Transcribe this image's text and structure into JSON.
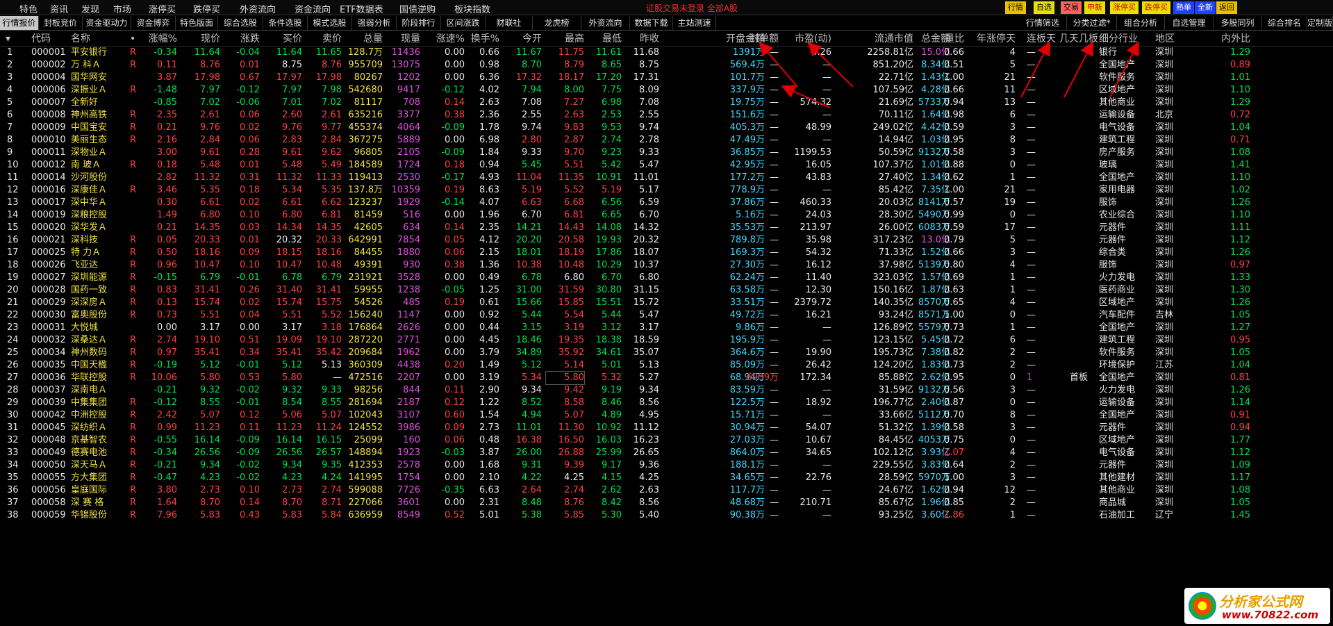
{
  "window": {
    "title": "证股交易未登录  全部A股"
  },
  "menu": [
    "特色",
    "资讯",
    "发现",
    "市场",
    "涨停买",
    "跌停买",
    "外资流向",
    "资金流向",
    "ETF数据表",
    "国债逆购",
    "板块指数"
  ],
  "quick_buttons": [
    "行情",
    "自选",
    "交易",
    "申新",
    "涨停买",
    "跌停买",
    "熟单",
    "全新",
    "返回"
  ],
  "tabs_left": [
    "行情报价",
    "封板竞价",
    "资金驱动力",
    "资金博弈",
    "特色版面",
    "综合选股",
    "条件选股",
    "模式选股",
    "强弱分析",
    "阶段排行",
    "区间涨跌",
    "财联社",
    "龙虎榜",
    "外资流向",
    "数据下载",
    "主站测速"
  ],
  "tabs_right": [
    "行情筛选",
    "分类过滤*",
    "组合分析",
    "自选管理",
    "多股同列",
    "综合排名",
    "定制版面"
  ],
  "columns": [
    "",
    "代码",
    "名称",
    "•",
    "涨幅%",
    "现价",
    "涨跌",
    "买价",
    "卖价",
    "总量",
    "现量",
    "涨速%",
    "换手%",
    "今开",
    "最高",
    "最低",
    "昨收",
    "开盘金额",
    "封单额",
    "市盈(动)",
    "流通市值",
    "总金额",
    "量比",
    "年涨停天",
    "连板天",
    "几天几板",
    "细分行业",
    "地区",
    "内外比"
  ],
  "rows": [
    [
      "1",
      "000001",
      "平安银行",
      "R",
      "-0.34",
      "11.64",
      "-0.04",
      "11.64",
      "11.65",
      "128.7万",
      "11436",
      "0.00",
      "0.66",
      "11.67",
      "11.75",
      "11.61",
      "11.68",
      "1391万",
      "—",
      "4.26",
      "2258.81亿",
      "15.0亿",
      "0.66",
      "4",
      "—",
      "",
      "银行",
      "深圳",
      "1.29"
    ],
    [
      "2",
      "000002",
      "万 科Ａ",
      "R",
      "0.11",
      "8.76",
      "0.01",
      "8.75",
      "8.76",
      "955709",
      "13075",
      "0.00",
      "0.98",
      "8.70",
      "8.79",
      "8.65",
      "8.75",
      "569.4万",
      "—",
      "—",
      "851.20亿",
      "8.34亿",
      "0.51",
      "5",
      "—",
      "",
      "全国地产",
      "深圳",
      "0.89"
    ],
    [
      "3",
      "000004",
      "国华网安",
      "",
      "3.87",
      "17.98",
      "0.67",
      "17.97",
      "17.98",
      "80267",
      "1202",
      "0.00",
      "6.36",
      "17.32",
      "18.17",
      "17.20",
      "17.31",
      "101.7万",
      "—",
      "—",
      "22.71亿",
      "1.43亿",
      "1.00",
      "21",
      "—",
      "",
      "软件服务",
      "深圳",
      "1.01"
    ],
    [
      "4",
      "000006",
      "深振业Ａ",
      "R",
      "-1.48",
      "7.97",
      "-0.12",
      "7.97",
      "7.98",
      "542680",
      "9417",
      "-0.12",
      "4.02",
      "7.94",
      "8.00",
      "7.75",
      "8.09",
      "337.9万",
      "—",
      "—",
      "107.59亿",
      "4.28亿",
      "0.66",
      "11",
      "—",
      "",
      "区域地产",
      "深圳",
      "1.10"
    ],
    [
      "5",
      "000007",
      "全新好",
      "",
      "-0.85",
      "7.02",
      "-0.06",
      "7.01",
      "7.02",
      "81117",
      "708",
      "0.14",
      "2.63",
      "7.08",
      "7.27",
      "6.98",
      "7.08",
      "19.75万",
      "—",
      "574.32",
      "21.69亿",
      "5733万",
      "0.94",
      "13",
      "—",
      "",
      "其他商业",
      "深圳",
      "1.29"
    ],
    [
      "6",
      "000008",
      "神州高铁",
      "R",
      "2.35",
      "2.61",
      "0.06",
      "2.60",
      "2.61",
      "635216",
      "3377",
      "0.38",
      "2.36",
      "2.55",
      "2.63",
      "2.53",
      "2.55",
      "151.6万",
      "—",
      "—",
      "70.11亿",
      "1.64亿",
      "0.98",
      "6",
      "—",
      "",
      "运输设备",
      "北京",
      "0.72"
    ],
    [
      "7",
      "000009",
      "中国宝安",
      "R",
      "0.21",
      "9.76",
      "0.02",
      "9.76",
      "9.77",
      "455374",
      "4064",
      "-0.09",
      "1.78",
      "9.74",
      "9.83",
      "9.53",
      "9.74",
      "405.3万",
      "—",
      "48.99",
      "249.02亿",
      "4.42亿",
      "0.59",
      "3",
      "—",
      "",
      "电气设备",
      "深圳",
      "1.04"
    ],
    [
      "8",
      "000010",
      "美丽生态",
      "R",
      "2.16",
      "2.84",
      "0.06",
      "2.83",
      "2.84",
      "367275",
      "5889",
      "0.00",
      "6.98",
      "2.80",
      "2.87",
      "2.74",
      "2.78",
      "47.49万",
      "—",
      "—",
      "14.94亿",
      "1.03亿",
      "0.95",
      "8",
      "—",
      "",
      "建筑工程",
      "深圳",
      "0.71"
    ],
    [
      "9",
      "000011",
      "深物业Ａ",
      "",
      "3.00",
      "9.61",
      "0.28",
      "9.61",
      "9.62",
      "96805",
      "2105",
      "-0.09",
      "1.84",
      "9.33",
      "9.70",
      "9.23",
      "9.33",
      "36.85万",
      "—",
      "1199.53",
      "50.59亿",
      "9132万",
      "0.58",
      "3",
      "—",
      "",
      "房产服务",
      "深圳",
      "1.08"
    ],
    [
      "10",
      "000012",
      "南 玻Ａ",
      "R",
      "0.18",
      "5.48",
      "0.01",
      "5.48",
      "5.49",
      "184589",
      "1724",
      "0.18",
      "0.94",
      "5.45",
      "5.51",
      "5.42",
      "5.47",
      "42.95万",
      "—",
      "16.05",
      "107.37亿",
      "1.01亿",
      "0.88",
      "0",
      "—",
      "",
      "玻璃",
      "深圳",
      "1.41"
    ],
    [
      "11",
      "000014",
      "沙河股份",
      "",
      "2.82",
      "11.32",
      "0.31",
      "11.32",
      "11.33",
      "119413",
      "2530",
      "-0.17",
      "4.93",
      "11.04",
      "11.35",
      "10.91",
      "11.01",
      "177.2万",
      "—",
      "43.83",
      "27.40亿",
      "1.34亿",
      "0.62",
      "1",
      "—",
      "",
      "全国地产",
      "深圳",
      "1.10"
    ],
    [
      "12",
      "000016",
      "深康佳Ａ",
      "R",
      "3.46",
      "5.35",
      "0.18",
      "5.34",
      "5.35",
      "137.8万",
      "10359",
      "0.19",
      "8.63",
      "5.19",
      "5.52",
      "5.19",
      "5.17",
      "778.9万",
      "—",
      "—",
      "85.42亿",
      "7.35亿",
      "1.00",
      "21",
      "—",
      "",
      "家用电器",
      "深圳",
      "1.02"
    ],
    [
      "13",
      "000017",
      "深中华Ａ",
      "",
      "0.30",
      "6.61",
      "0.02",
      "6.61",
      "6.62",
      "123237",
      "1929",
      "-0.14",
      "4.07",
      "6.63",
      "6.68",
      "6.56",
      "6.59",
      "37.86万",
      "—",
      "460.33",
      "20.03亿",
      "8141万",
      "0.57",
      "19",
      "—",
      "",
      "服饰",
      "深圳",
      "1.26"
    ],
    [
      "14",
      "000019",
      "深粮控股",
      "",
      "1.49",
      "6.80",
      "0.10",
      "6.80",
      "6.81",
      "81459",
      "516",
      "0.00",
      "1.96",
      "6.70",
      "6.81",
      "6.65",
      "6.70",
      "5.16万",
      "—",
      "24.03",
      "28.30亿",
      "5490万",
      "0.99",
      "0",
      "—",
      "",
      "农业综合",
      "深圳",
      "1.10"
    ],
    [
      "15",
      "000020",
      "深华发Ａ",
      "",
      "0.21",
      "14.35",
      "0.03",
      "14.34",
      "14.35",
      "42605",
      "634",
      "0.14",
      "2.35",
      "14.21",
      "14.43",
      "14.08",
      "14.32",
      "35.53万",
      "—",
      "213.97",
      "26.00亿",
      "6083万",
      "0.59",
      "17",
      "—",
      "",
      "元器件",
      "深圳",
      "1.11"
    ],
    [
      "16",
      "000021",
      "深科技",
      "R",
      "0.05",
      "20.33",
      "0.01",
      "20.32",
      "20.33",
      "642991",
      "7854",
      "0.05",
      "4.12",
      "20.20",
      "20.58",
      "19.93",
      "20.32",
      "789.8万",
      "—",
      "35.98",
      "317.23亿",
      "13.0亿",
      "0.79",
      "5",
      "—",
      "",
      "元器件",
      "深圳",
      "1.12"
    ],
    [
      "17",
      "000025",
      "特 力Ａ",
      "R",
      "0.50",
      "18.16",
      "0.09",
      "18.15",
      "18.16",
      "84455",
      "1880",
      "0.06",
      "2.15",
      "18.01",
      "18.19",
      "17.86",
      "18.07",
      "169.3万",
      "—",
      "54.32",
      "71.33亿",
      "1.52亿",
      "0.66",
      "3",
      "—",
      "",
      "综合类",
      "深圳",
      "1.26"
    ],
    [
      "18",
      "000026",
      "飞亚达",
      "R",
      "0.96",
      "10.47",
      "0.10",
      "10.47",
      "10.48",
      "49391",
      "930",
      "0.38",
      "1.36",
      "10.38",
      "10.48",
      "10.29",
      "10.37",
      "27.30万",
      "—",
      "16.12",
      "37.98亿",
      "5139万",
      "0.80",
      "4",
      "—",
      "",
      "服饰",
      "深圳",
      "0.97"
    ],
    [
      "19",
      "000027",
      "深圳能源",
      "R",
      "-0.15",
      "6.79",
      "-0.01",
      "6.78",
      "6.79",
      "231921",
      "3528",
      "0.00",
      "0.49",
      "6.78",
      "6.80",
      "6.70",
      "6.80",
      "62.24万",
      "—",
      "11.40",
      "323.03亿",
      "1.57亿",
      "0.69",
      "1",
      "—",
      "",
      "火力发电",
      "深圳",
      "1.33"
    ],
    [
      "20",
      "000028",
      "国药一致",
      "R",
      "0.83",
      "31.41",
      "0.26",
      "31.40",
      "31.41",
      "59955",
      "1238",
      "-0.05",
      "1.25",
      "31.00",
      "31.59",
      "30.80",
      "31.15",
      "63.58万",
      "—",
      "12.30",
      "150.16亿",
      "1.87亿",
      "0.63",
      "1",
      "—",
      "",
      "医药商业",
      "深圳",
      "1.30"
    ],
    [
      "21",
      "000029",
      "深深房Ａ",
      "R",
      "0.13",
      "15.74",
      "0.02",
      "15.74",
      "15.75",
      "54526",
      "485",
      "0.19",
      "0.61",
      "15.66",
      "15.85",
      "15.51",
      "15.72",
      "33.51万",
      "—",
      "2379.72",
      "140.35亿",
      "8570万",
      "0.65",
      "4",
      "—",
      "",
      "区域地产",
      "深圳",
      "1.26"
    ],
    [
      "22",
      "000030",
      "富奥股份",
      "R",
      "0.73",
      "5.51",
      "0.04",
      "5.51",
      "5.52",
      "156240",
      "1147",
      "0.00",
      "0.92",
      "5.44",
      "5.54",
      "5.44",
      "5.47",
      "49.72万",
      "—",
      "16.21",
      "93.24亿",
      "8571万",
      "1.00",
      "0",
      "—",
      "",
      "汽车配件",
      "吉林",
      "1.05"
    ],
    [
      "23",
      "000031",
      "大悦城",
      "",
      "0.00",
      "3.17",
      "0.00",
      "3.17",
      "3.18",
      "176864",
      "2626",
      "0.00",
      "0.44",
      "3.15",
      "3.19",
      "3.12",
      "3.17",
      "9.86万",
      "—",
      "—",
      "126.89亿",
      "5579万",
      "0.73",
      "1",
      "—",
      "",
      "全国地产",
      "深圳",
      "1.27"
    ],
    [
      "24",
      "000032",
      "深桑达Ａ",
      "R",
      "2.74",
      "19.10",
      "0.51",
      "19.09",
      "19.10",
      "287220",
      "2771",
      "0.00",
      "4.45",
      "18.46",
      "19.35",
      "18.38",
      "18.59",
      "195.9万",
      "—",
      "—",
      "123.15亿",
      "5.45亿",
      "0.72",
      "6",
      "—",
      "",
      "建筑工程",
      "深圳",
      "0.95"
    ],
    [
      "25",
      "000034",
      "神州数码",
      "R",
      "0.97",
      "35.41",
      "0.34",
      "35.41",
      "35.42",
      "209684",
      "1962",
      "0.00",
      "3.79",
      "34.89",
      "35.92",
      "34.61",
      "35.07",
      "364.6万",
      "—",
      "19.90",
      "195.73亿",
      "7.38亿",
      "0.82",
      "2",
      "—",
      "",
      "软件服务",
      "深圳",
      "1.05"
    ],
    [
      "26",
      "000035",
      "中国天楹",
      "R",
      "-0.19",
      "5.12",
      "-0.01",
      "5.12",
      "5.13",
      "360309",
      "4438",
      "0.20",
      "1.49",
      "5.12",
      "5.14",
      "5.01",
      "5.13",
      "85.09万",
      "—",
      "26.42",
      "124.20亿",
      "1.83亿",
      "0.73",
      "2",
      "—",
      "",
      "环境保护",
      "江苏",
      "1.04"
    ],
    [
      "27",
      "000036",
      "华联控股",
      "R",
      "10.06",
      "5.80",
      "0.53",
      "5.80",
      "—",
      "472516",
      "2207",
      "0.00",
      "3.19",
      "5.34",
      "5.80",
      "5.32",
      "5.27",
      "68.94万",
      "6939万",
      "172.34",
      "85.88亿",
      "2.62亿",
      "0.95",
      "0",
      "1",
      "首板",
      "全国地产",
      "深圳",
      "0.81"
    ],
    [
      "28",
      "000037",
      "深南电Ａ",
      "",
      "-0.21",
      "9.32",
      "-0.02",
      "9.32",
      "9.33",
      "98256",
      "844",
      "0.11",
      "2.90",
      "9.34",
      "9.42",
      "9.19",
      "9.34",
      "83.59万",
      "—",
      "—",
      "31.59亿",
      "9132万",
      "0.56",
      "3",
      "—",
      "",
      "火力发电",
      "深圳",
      "1.26"
    ],
    [
      "29",
      "000039",
      "中集集团",
      "R",
      "-0.12",
      "8.55",
      "-0.01",
      "8.54",
      "8.55",
      "281694",
      "2187",
      "0.12",
      "1.22",
      "8.52",
      "8.58",
      "8.46",
      "8.56",
      "122.5万",
      "—",
      "18.92",
      "196.77亿",
      "2.40亿",
      "0.87",
      "0",
      "—",
      "",
      "运输设备",
      "深圳",
      "1.14"
    ],
    [
      "30",
      "000042",
      "中洲控股",
      "R",
      "2.42",
      "5.07",
      "0.12",
      "5.06",
      "5.07",
      "102043",
      "3107",
      "0.60",
      "1.54",
      "4.94",
      "5.07",
      "4.89",
      "4.95",
      "15.71万",
      "—",
      "—",
      "33.66亿",
      "5112万",
      "0.70",
      "8",
      "—",
      "",
      "全国地产",
      "深圳",
      "0.91"
    ],
    [
      "31",
      "000045",
      "深纺织Ａ",
      "R",
      "0.99",
      "11.23",
      "0.11",
      "11.23",
      "11.24",
      "124552",
      "3986",
      "0.09",
      "2.73",
      "11.01",
      "11.30",
      "10.92",
      "11.12",
      "30.94万",
      "—",
      "54.07",
      "51.32亿",
      "1.39亿",
      "0.58",
      "3",
      "—",
      "",
      "元器件",
      "深圳",
      "0.94"
    ],
    [
      "32",
      "000048",
      "京基智农",
      "R",
      "-0.55",
      "16.14",
      "-0.09",
      "16.14",
      "16.15",
      "25099",
      "160",
      "0.06",
      "0.48",
      "16.38",
      "16.50",
      "16.03",
      "16.23",
      "27.03万",
      "—",
      "10.67",
      "84.45亿",
      "4053万",
      "0.75",
      "0",
      "—",
      "",
      "区域地产",
      "深圳",
      "1.77"
    ],
    [
      "33",
      "000049",
      "德赛电池",
      "R",
      "-0.34",
      "26.56",
      "-0.09",
      "26.56",
      "26.57",
      "148894",
      "1923",
      "-0.03",
      "3.87",
      "26.00",
      "26.88",
      "25.99",
      "26.65",
      "864.0万",
      "—",
      "34.65",
      "102.12亿",
      "3.93亿",
      "1.07",
      "4",
      "—",
      "",
      "电气设备",
      "深圳",
      "1.12"
    ],
    [
      "34",
      "000050",
      "深天马Ａ",
      "R",
      "-0.21",
      "9.34",
      "-0.02",
      "9.34",
      "9.35",
      "412353",
      "2578",
      "0.00",
      "1.68",
      "9.31",
      "9.39",
      "9.17",
      "9.36",
      "188.1万",
      "—",
      "—",
      "229.55亿",
      "3.83亿",
      "0.64",
      "2",
      "—",
      "",
      "元器件",
      "深圳",
      "1.09"
    ],
    [
      "35",
      "000055",
      "方大集团",
      "R",
      "-0.47",
      "4.23",
      "-0.02",
      "4.23",
      "4.24",
      "141995",
      "1754",
      "0.00",
      "2.10",
      "4.22",
      "4.25",
      "4.15",
      "4.25",
      "34.65万",
      "—",
      "22.76",
      "28.59亿",
      "5970万",
      "1.00",
      "3",
      "—",
      "",
      "其他建材",
      "深圳",
      "1.17"
    ],
    [
      "36",
      "000056",
      "皇庭国际",
      "R",
      "3.80",
      "2.73",
      "0.10",
      "2.73",
      "2.74",
      "599088",
      "7726",
      "-0.35",
      "6.63",
      "2.64",
      "2.74",
      "2.62",
      "2.63",
      "117.7万",
      "—",
      "—",
      "24.67亿",
      "1.62亿",
      "0.94",
      "12",
      "—",
      "",
      "其他商业",
      "深圳",
      "1.08"
    ],
    [
      "37",
      "000058",
      "深 赛 格",
      "R",
      "1.64",
      "8.70",
      "0.14",
      "8.70",
      "8.71",
      "227066",
      "3601",
      "0.00",
      "2.31",
      "8.48",
      "8.76",
      "8.42",
      "8.56",
      "48.68万",
      "—",
      "210.71",
      "85.67亿",
      "1.96亿",
      "0.85",
      "2",
      "—",
      "",
      "商品城",
      "深圳",
      "1.05"
    ],
    [
      "38",
      "000059",
      "华锦股份",
      "R",
      "7.96",
      "5.83",
      "0.43",
      "5.83",
      "5.84",
      "636959",
      "8549",
      "0.52",
      "5.01",
      "5.38",
      "5.85",
      "5.30",
      "5.40",
      "90.38万",
      "—",
      "—",
      "93.25亿",
      "3.60亿",
      "1.86",
      "1",
      "—",
      "",
      "石油加工",
      "辽宁",
      "1.45"
    ]
  ],
  "watermark": {
    "line1": "分析家公式网",
    "line2": "www.70822.com"
  },
  "colors": {
    "up": "#ff4040",
    "down": "#00e050",
    "flat": "#e8e8e8",
    "amount": "#40d8ff",
    "volume": "#e050e0",
    "code": "#e8e8e8",
    "name": "#f0e040",
    "bg": "#000000",
    "arrow": "#e00000"
  }
}
